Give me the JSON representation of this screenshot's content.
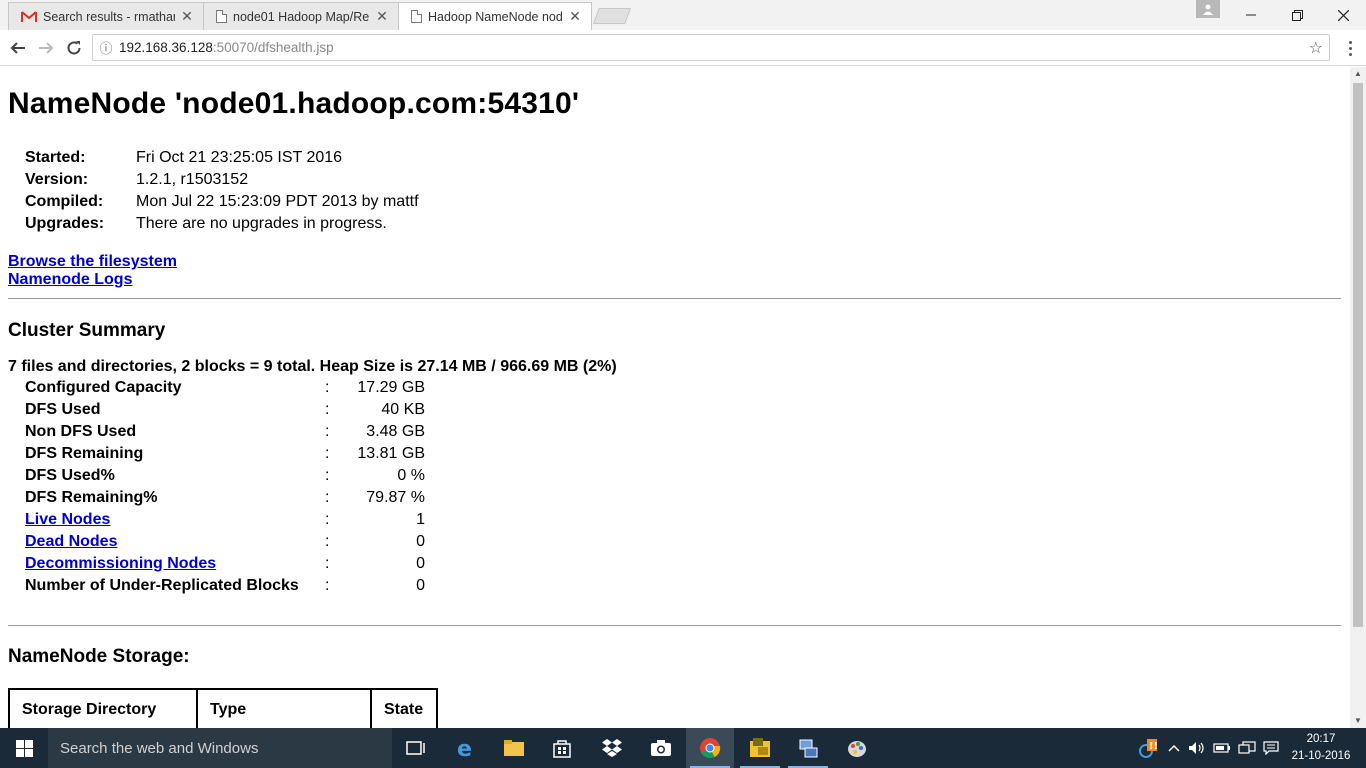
{
  "browser": {
    "tabs": [
      {
        "title": "Search results - rmathan",
        "icon": "gmail-icon"
      },
      {
        "title": "node01 Hadoop Map/Re",
        "icon": "page-icon"
      },
      {
        "title": "Hadoop NameNode nod",
        "icon": "page-icon"
      }
    ],
    "url_host": "192.168.36.128",
    "url_rest": ":50070/dfshealth.jsp"
  },
  "page": {
    "title": "NameNode 'node01.hadoop.com:54310'",
    "info": [
      {
        "key": "Started:",
        "value": "Fri Oct 21 23:25:05 IST 2016"
      },
      {
        "key": "Version:",
        "value": "1.2.1, r1503152"
      },
      {
        "key": "Compiled:",
        "value": "Mon Jul 22 15:23:09 PDT 2013 by mattf"
      },
      {
        "key": "Upgrades:",
        "value": "There are no upgrades in progress."
      }
    ],
    "links": {
      "browse": "Browse the filesystem",
      "logs": "Namenode Logs"
    },
    "cluster_summary": {
      "heading": "Cluster Summary",
      "summary_line": "7 files and directories, 2 blocks = 9 total. Heap Size is 27.14 MB / 966.69 MB (2%)",
      "rows": [
        {
          "key": "Configured Capacity",
          "value": "17.29 GB"
        },
        {
          "key": "DFS Used",
          "value": "40 KB"
        },
        {
          "key": "Non DFS Used",
          "value": "3.48 GB"
        },
        {
          "key": "DFS Remaining",
          "value": "13.81 GB"
        },
        {
          "key": "DFS Used%",
          "value": "0 %"
        },
        {
          "key": "DFS Remaining%",
          "value": "79.87 %"
        },
        {
          "key": "Live Nodes",
          "value": "1"
        },
        {
          "key": "Dead Nodes",
          "value": "0"
        },
        {
          "key": "Decommissioning Nodes",
          "value": "0"
        },
        {
          "key": "Number of Under-Replicated Blocks",
          "value": "0"
        }
      ],
      "colon": ":"
    },
    "storage": {
      "heading": "NameNode Storage:",
      "columns": [
        "Storage Directory",
        "Type",
        "State"
      ]
    }
  },
  "taskbar": {
    "search_placeholder": "Search the web and Windows",
    "time": "20:17",
    "date": "21-10-2016"
  }
}
